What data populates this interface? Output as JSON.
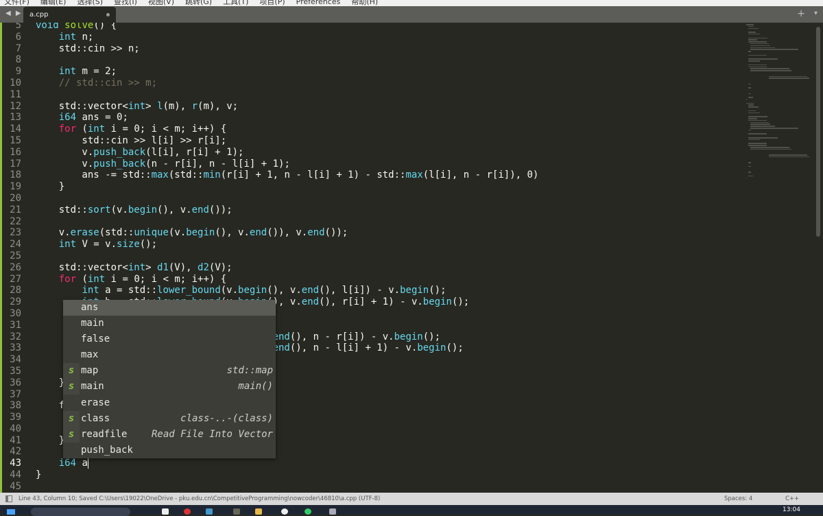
{
  "menu": [
    "文件(F)",
    "编辑(E)",
    "选择(S)",
    "查找(I)",
    "视图(V)",
    "跳转(G)",
    "工具(T)",
    "项目(P)",
    "Preferences",
    "帮助(H)"
  ],
  "tabs": {
    "nav": "◀ ▶",
    "active": "a.cpp",
    "plus": "+",
    "dropdown": "▾"
  },
  "editor": {
    "first_line": 5,
    "current_line": 43,
    "lines": [
      "void solve() {",
      "    int n;",
      "    std::cin >> n;",
      "",
      "    int m = 2;",
      "    // std::cin >> m;",
      "",
      "    std::vector<int> l(m), r(m), v;",
      "    i64 ans = 0;",
      "    for (int i = 0; i < m; i++) {",
      "        std::cin >> l[i] >> r[i];",
      "        v.push_back(l[i], r[i] + 1);",
      "        v.push_back(n - r[i], n - l[i] + 1);",
      "        ans -= std::max(std::min(r[i] + 1, n - l[i] + 1) - std::max(l[i], n - r[i]), 0)",
      "    }",
      "",
      "    std::sort(v.begin(), v.end());",
      "",
      "    v.erase(std::unique(v.begin(), v.end()), v.end());",
      "    int V = v.size();",
      "",
      "    std::vector<int> d1(V), d2(V);",
      "    for (int i = 0; i < m; i++) {",
      "        int a = std::lower_bound(v.begin(), v.end(), l[i]) - v.begin();",
      "        int b = std::lower_bound(v.begin(), v.end(), r[i] + 1) - v.begin();",
      "",
      "",
      "                                         end(), n - r[i]) - v.begin();",
      "                                         end(), n - l[i] + 1) - v.begin();",
      "",
      "",
      "    }",
      "",
      "    f",
      "",
      "",
      "    }",
      "",
      "    i64 a",
      "}",
      ""
    ]
  },
  "autocomplete": [
    {
      "label": "ans",
      "kind": "",
      "hint": "",
      "selected": true
    },
    {
      "label": "main",
      "kind": "",
      "hint": ""
    },
    {
      "label": "false",
      "kind": "",
      "hint": ""
    },
    {
      "label": "max",
      "kind": "",
      "hint": ""
    },
    {
      "label": "map",
      "kind": "s",
      "hint": "std::map"
    },
    {
      "label": "main",
      "kind": "s",
      "hint": "main()"
    },
    {
      "label": "erase",
      "kind": "",
      "hint": ""
    },
    {
      "label": "class",
      "kind": "s",
      "hint": "class-..-(class)"
    },
    {
      "label": "readfile",
      "kind": "s",
      "hint": "Read File Into Vector"
    },
    {
      "label": "push_back",
      "kind": "",
      "hint": ""
    }
  ],
  "status": {
    "message": "Line 43, Column 10; Saved C:\\Users\\19022\\OneDrive - pku.edu.cn\\CompetitiveProgramming\\nowcoder\\46810\\a.cpp (UTF-8)",
    "spaces": "Spaces: 4",
    "syntax": "C++"
  },
  "taskbar": {
    "time": "13:04"
  },
  "colors": {
    "background": "#272822",
    "keyword": "#f92672",
    "type": "#66d9ef",
    "number": "#ae81ff",
    "comment": "#75715e",
    "function_def": "#a6e22e",
    "snippet_kind": "#8bc34a"
  }
}
